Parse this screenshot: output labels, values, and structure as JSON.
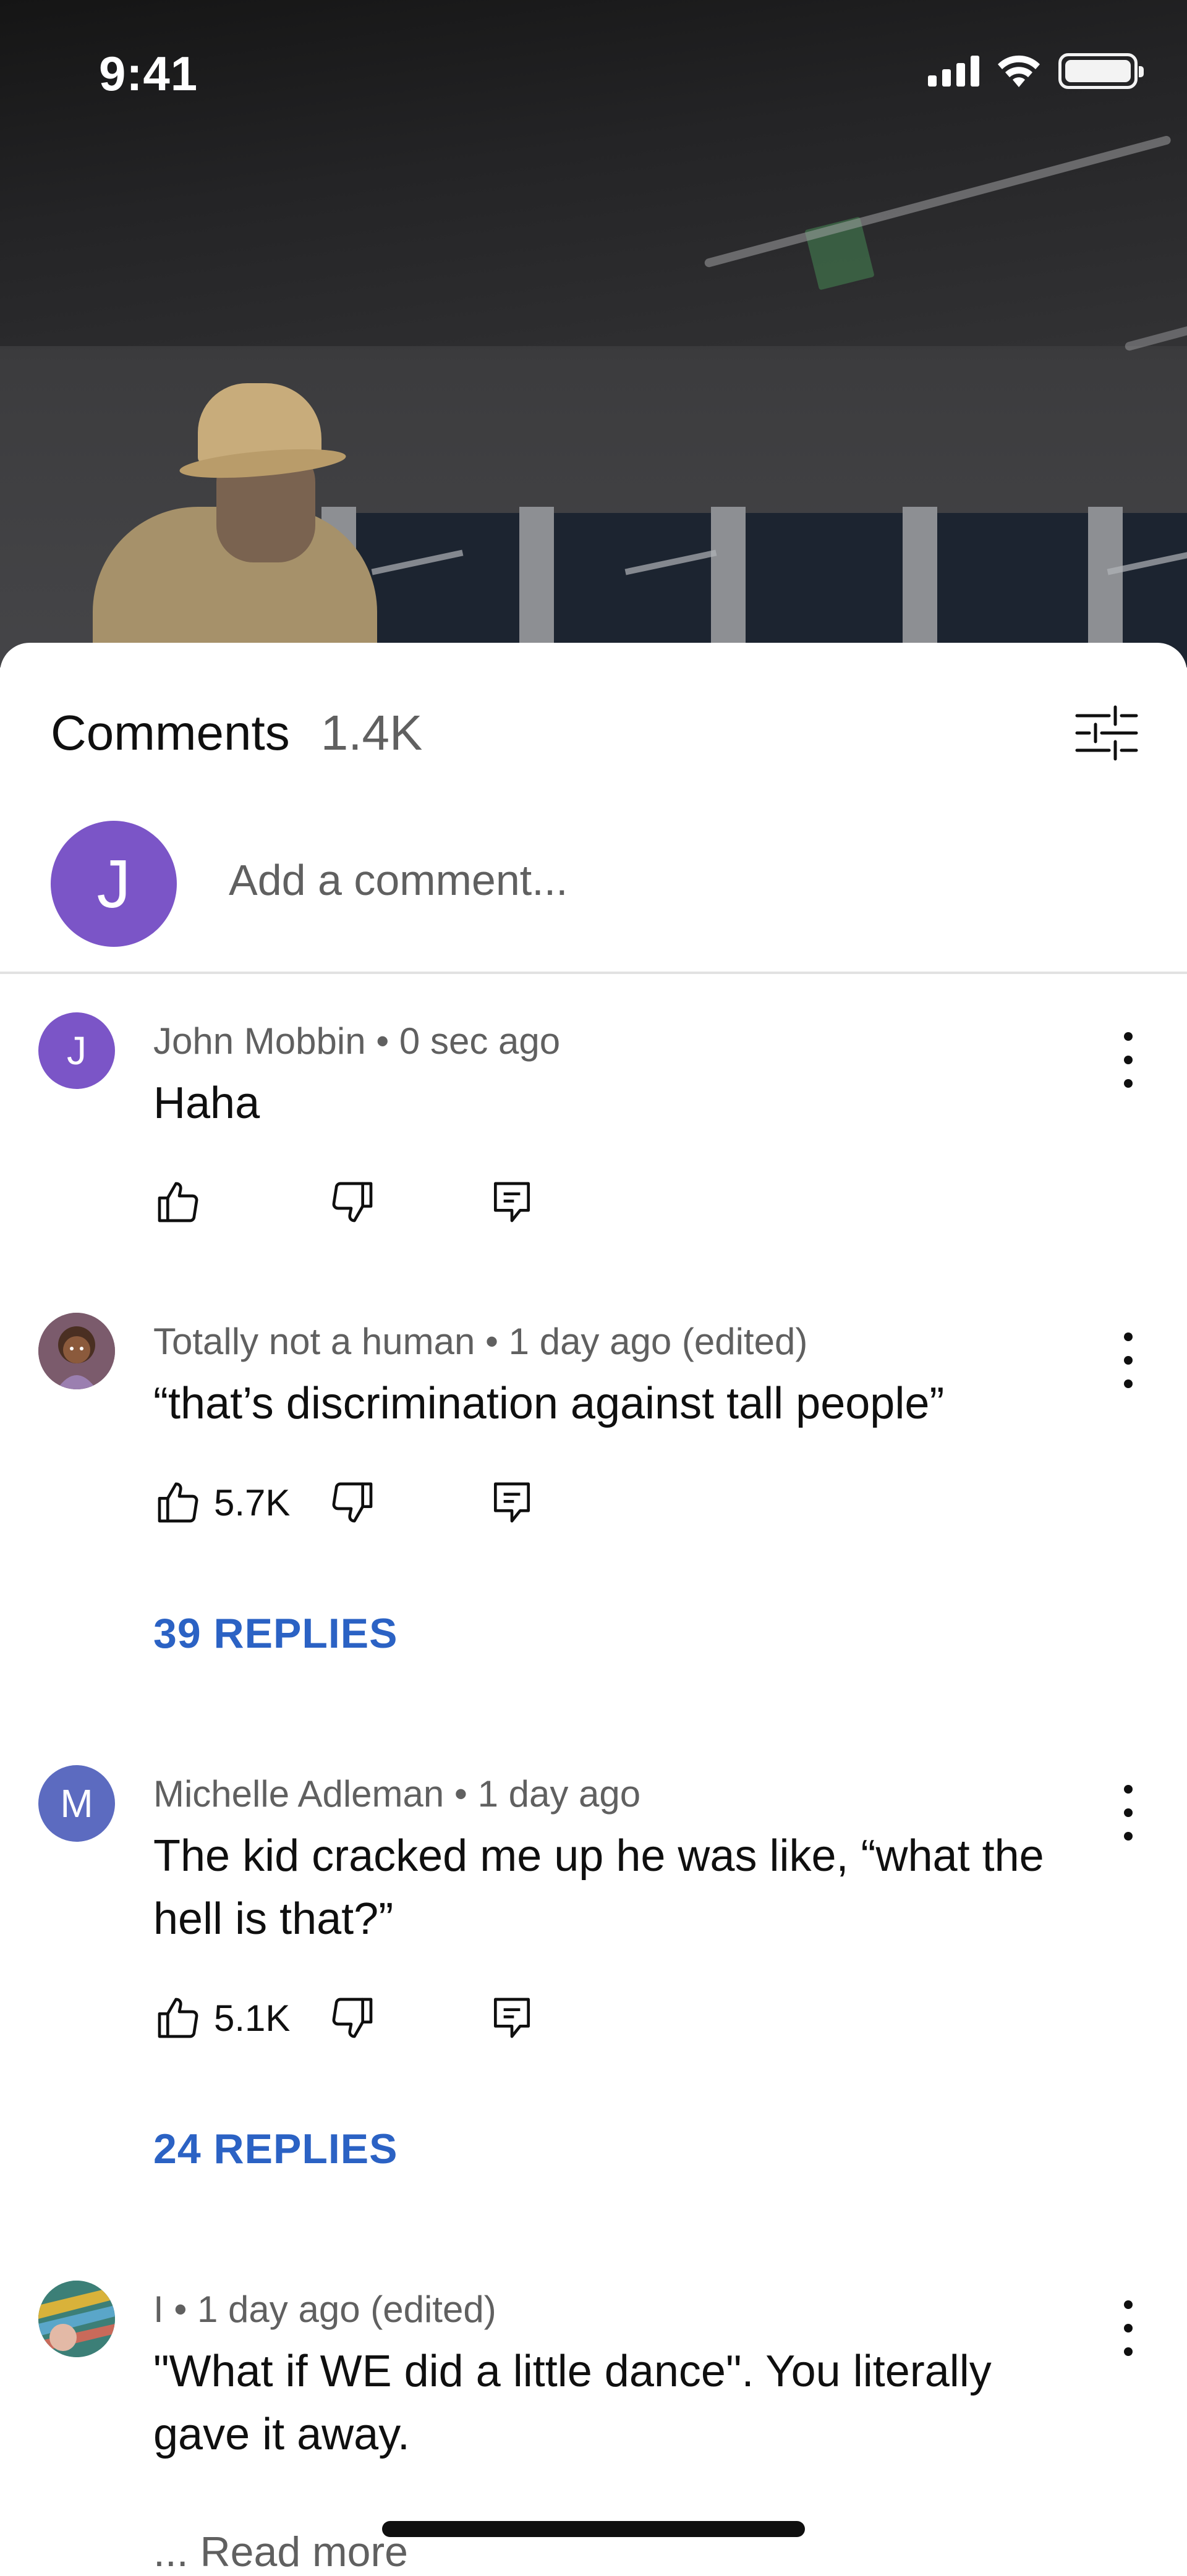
{
  "status_bar": {
    "time": "9:41",
    "battery_level": 1.0
  },
  "sheet": {
    "title": "Comments",
    "count": "1.4K",
    "add_comment": {
      "avatar_letter": "J",
      "avatar_color": "#7b55c7",
      "placeholder": "Add a comment..."
    }
  },
  "comments": [
    {
      "avatar_letter": "J",
      "avatar_color": "#7b55c7",
      "author": "John Mobbin",
      "time": "0 sec ago",
      "meta": "John Mobbin • 0 sec ago",
      "text": "Haha",
      "likes": ""
    },
    {
      "avatar_letter": "",
      "avatar_icon": "cartoon-avatar",
      "author": "Totally not a human",
      "time": "1 day ago (edited)",
      "meta": "Totally not a human • 1 day ago (edited)",
      "text": "“that’s discrimination against tall people”",
      "likes": "5.7K",
      "replies": "39 REPLIES"
    },
    {
      "avatar_letter": "M",
      "avatar_color": "#5c6bc0",
      "author": "Michelle Adleman",
      "time": "1 day ago",
      "meta": "Michelle Adleman • 1 day ago",
      "text": "The kid cracked me up he was like, “what the hell is that?”",
      "likes": "5.1K",
      "replies": "24 REPLIES"
    },
    {
      "avatar_letter": "",
      "avatar_icon": "colorful-photo-avatar",
      "author": "I",
      "time": "1 day ago (edited)",
      "meta": "I • 1 day ago (edited)",
      "text": "\"What if WE did a little dance\". You literally gave it away.",
      "read_more": "... Read more"
    }
  ],
  "colors": {
    "link": "#2b62c4",
    "secondary_text": "#606060",
    "primary_text": "#0f0f0f"
  }
}
